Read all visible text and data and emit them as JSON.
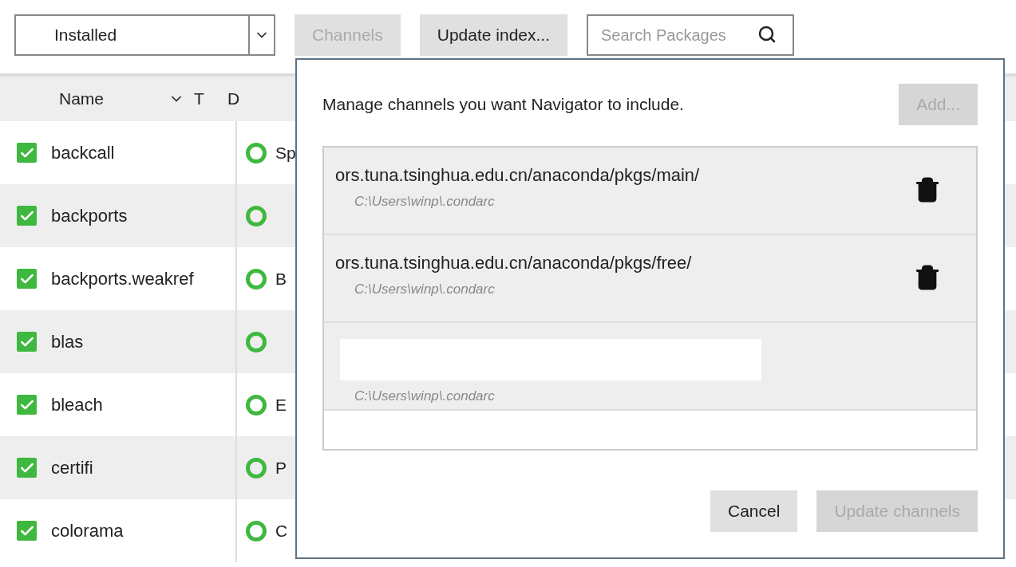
{
  "toolbar": {
    "filter": {
      "value": "Installed"
    },
    "channels_button": {
      "label": "Channels",
      "disabled": true
    },
    "update_button": {
      "label": "Update index...",
      "disabled": false
    },
    "search": {
      "placeholder": "Search Packages"
    }
  },
  "table": {
    "columns": [
      "Name",
      "T",
      "D"
    ],
    "rows": [
      {
        "name": "backcall",
        "checked": true,
        "description": "Sp"
      },
      {
        "name": "backports",
        "checked": true
      },
      {
        "name": "backports.weakref",
        "checked": true,
        "description": "B"
      },
      {
        "name": "blas",
        "checked": true
      },
      {
        "name": "bleach",
        "checked": true,
        "description": "E"
      },
      {
        "name": "certifi",
        "checked": true,
        "description": "P"
      },
      {
        "name": "colorama",
        "checked": true,
        "description": "C"
      }
    ]
  },
  "dialog": {
    "message": "Manage channels you want Navigator to include.",
    "add_button": {
      "label": "Add...",
      "disabled": true
    },
    "channels": [
      {
        "kind": "text",
        "url": "ors.tuna.tsinghua.edu.cn/anaconda/pkgs/main/",
        "source": "C:\\Users\\winp\\.condarc"
      },
      {
        "kind": "text",
        "url": "ors.tuna.tsinghua.edu.cn/anaconda/pkgs/free/",
        "source": "C:\\Users\\winp\\.condarc"
      },
      {
        "kind": "input",
        "source": "C:\\Users\\winp\\.condarc"
      }
    ],
    "buttons": [
      {
        "label": "Cancel",
        "disabled": false
      },
      {
        "label": "Update channels",
        "disabled": true
      }
    ]
  }
}
